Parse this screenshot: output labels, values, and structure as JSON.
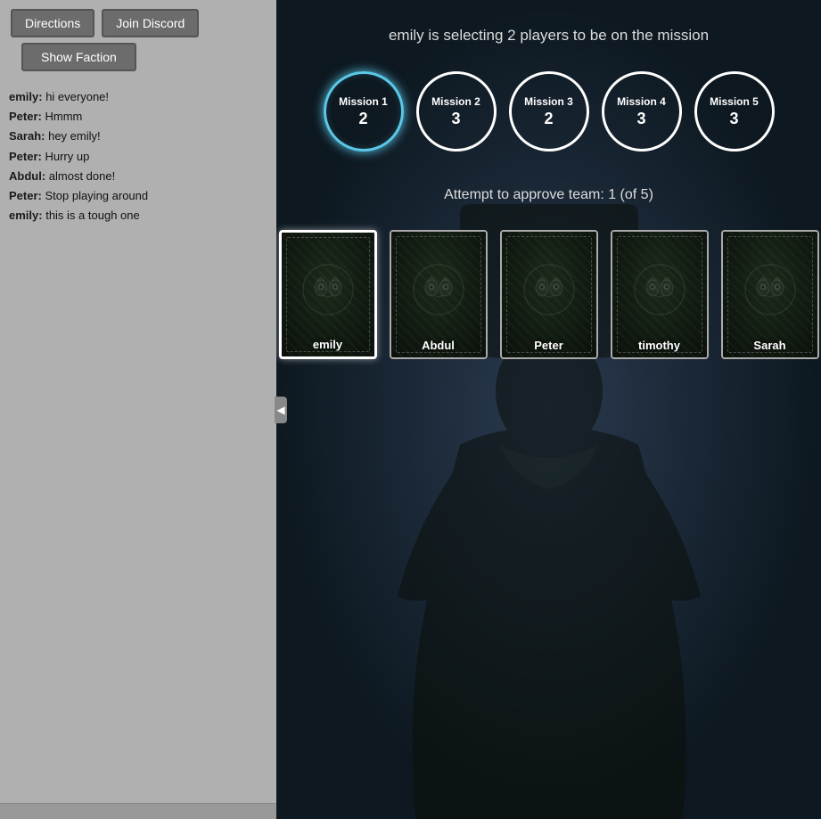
{
  "left_panel": {
    "buttons": {
      "directions_label": "Directions",
      "join_discord_label": "Join Discord",
      "show_faction_label": "Show Faction"
    },
    "chat": [
      {
        "sender": "emily",
        "sender_class": "emily-sender",
        "message": "hi everyone!"
      },
      {
        "sender": "Peter",
        "sender_class": "peter-sender",
        "message": "Hmmm"
      },
      {
        "sender": "Sarah",
        "sender_class": "sarah-sender",
        "message": "hey emily!"
      },
      {
        "sender": "Peter",
        "sender_class": "peter-sender",
        "message": "Hurry up"
      },
      {
        "sender": "Abdul",
        "sender_class": "abdul-sender",
        "message": "almost done!"
      },
      {
        "sender": "Peter",
        "sender_class": "peter-sender",
        "message": "Stop playing around"
      },
      {
        "sender": "emily",
        "sender_class": "emily-sender",
        "message": "this is a tough one"
      }
    ]
  },
  "game": {
    "selection_message": "emily is selecting 2 players to be on the mission",
    "attempt_text": "Attempt to approve team: 1 (of 5)",
    "missions": [
      {
        "label": "Mission 1",
        "num": "2",
        "active": true
      },
      {
        "label": "Mission 2",
        "num": "3",
        "active": false
      },
      {
        "label": "Mission 3",
        "num": "2",
        "active": false
      },
      {
        "label": "Mission 4",
        "num": "3",
        "active": false
      },
      {
        "label": "Mission 5",
        "num": "3",
        "active": false
      }
    ],
    "players": [
      {
        "name": "emily",
        "selected": true
      },
      {
        "name": "Abdul",
        "selected": false
      },
      {
        "name": "Peter",
        "selected": false
      },
      {
        "name": "timothy",
        "selected": false
      },
      {
        "name": "Sarah",
        "selected": false
      }
    ]
  }
}
